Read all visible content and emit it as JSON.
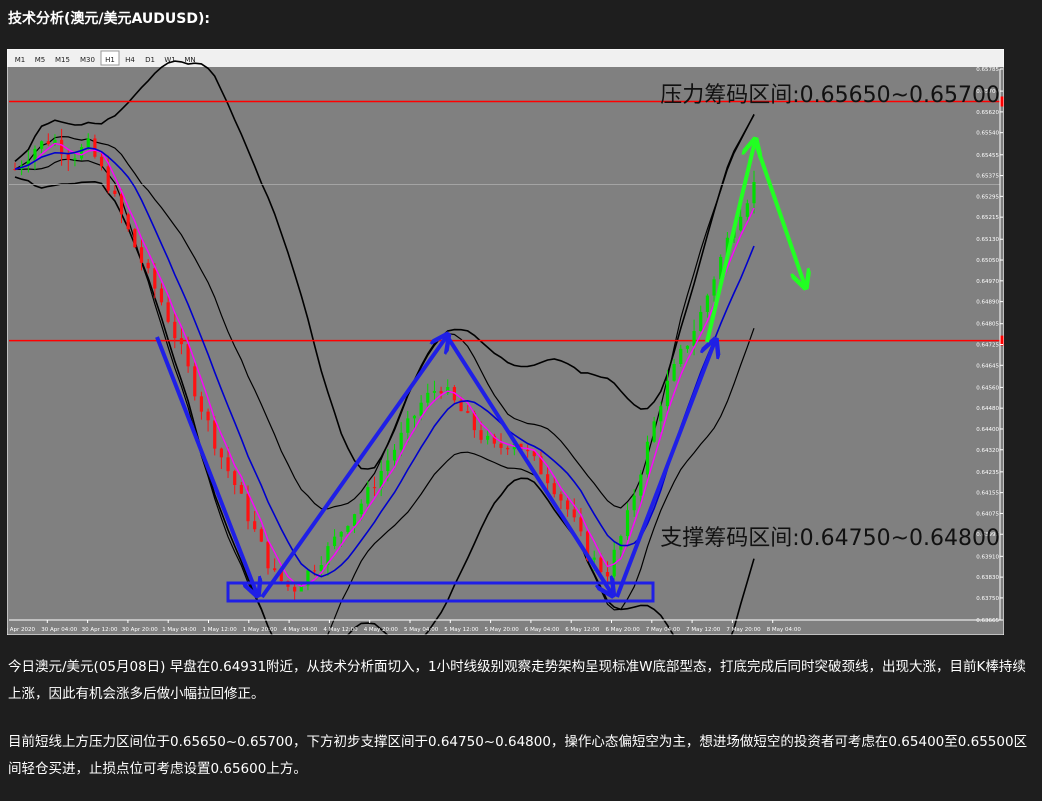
{
  "header": {
    "title": "技术分析(澳元/美元AUDUSD):"
  },
  "toolbar": {
    "timeframes": [
      "M1",
      "M5",
      "M15",
      "M30",
      "H1",
      "H4",
      "D1",
      "W1",
      "MN"
    ],
    "active": "H1"
  },
  "annotations": {
    "resistance": "压力筹码区间:0.65650~0.65700",
    "support": "支撑筹码区间:0.64750~0.64800"
  },
  "paragraphs": [
    "今日澳元/美元(05月08日) 早盘在0.64931附近，从技术分析面切入，1小时线级别观察走势架构呈现标准W底部型态，打底完成后同时突破颈线，出现大涨，目前K棒持续上涨，因此有机会涨多后做小幅拉回修正。",
    "目前短线上方压力区间位于0.65650~0.65700，下方初步支撑区间于0.64750~0.64800，操作心态偏短空为主，想进场做短空的投资者可考虑在0.65400至0.65500区间轻仓买进，止损点位可考虑设置0.65600上方。"
  ],
  "colors": {
    "page_bg": "#1e1e1e",
    "chart_bg": "#808080",
    "bull": "#00dd00",
    "bear": "#ff1111",
    "ma_fast": "#ff00ff",
    "ma_slow": "#0000cc",
    "band": "#000000",
    "horizontal": "#ff0000",
    "arrows_blue": "#1f1fe6",
    "arrows_green": "#22ff22"
  },
  "chart_data": {
    "type": "candlestick",
    "symbol": "AUDUSD",
    "timeframe": "H1",
    "ylim": [
      0.63665,
      0.65785
    ],
    "y_ticks": [
      "0.65785",
      "0.65700",
      "0.65620",
      "0.65540",
      "0.65455",
      "0.65375",
      "0.65295",
      "0.65215",
      "0.65130",
      "0.65050",
      "0.64970",
      "0.64890",
      "0.64805",
      "0.64725",
      "0.64645",
      "0.64560",
      "0.64480",
      "0.64400",
      "0.64320",
      "0.64235",
      "0.64155",
      "0.64075",
      "0.63995",
      "0.63910",
      "0.63830",
      "0.63750",
      "0.63665"
    ],
    "x_ticks": [
      "30 Apr 2020",
      "30 Apr 04:00",
      "30 Apr 12:00",
      "30 Apr 20:00",
      "1 May 04:00",
      "1 May 12:00",
      "1 May 20:00",
      "4 May 04:00",
      "4 May 12:00",
      "4 May 20:00",
      "5 May 04:00",
      "5 May 12:00",
      "5 May 20:00",
      "6 May 04:00",
      "6 May 12:00",
      "6 May 20:00",
      "7 May 04:00",
      "7 May 12:00",
      "7 May 20:00",
      "8 May 04:00"
    ],
    "horizontal_lines": [
      {
        "value": 0.6566,
        "label": "0.65660"
      },
      {
        "value": 0.6474,
        "label": "0.64740"
      }
    ],
    "current_price": {
      "value": 0.6534,
      "label": "0.65340"
    },
    "price_path": [
      0.654,
      0.6548,
      0.6552,
      0.6545,
      0.6549,
      0.6535,
      0.6518,
      0.6502,
      0.6488,
      0.647,
      0.645,
      0.6432,
      0.6417,
      0.64,
      0.6384,
      0.6378,
      0.6386,
      0.6394,
      0.6405,
      0.6414,
      0.6426,
      0.6438,
      0.645,
      0.6457,
      0.6448,
      0.6439,
      0.6432,
      0.6436,
      0.6428,
      0.642,
      0.6408,
      0.6392,
      0.6384,
      0.6402,
      0.6428,
      0.6452,
      0.6468,
      0.6482,
      0.6502,
      0.6521,
      0.6534
    ],
    "zones": [
      {
        "label": "support_box_low",
        "from": 0.6376,
        "to": 0.6385
      }
    ]
  }
}
